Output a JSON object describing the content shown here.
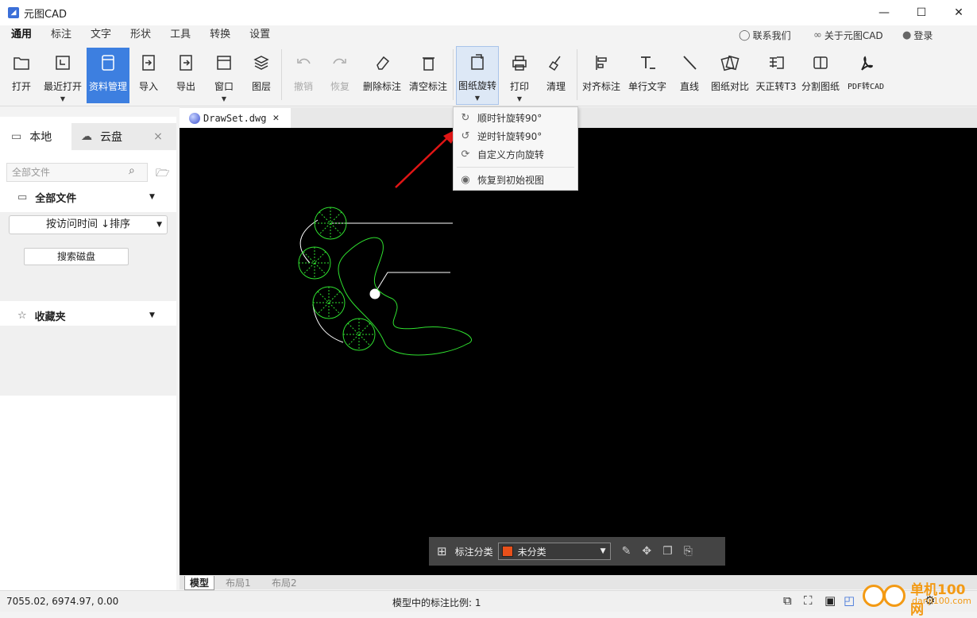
{
  "window": {
    "title": "元图CAD",
    "minimize": "—",
    "maximize": "☐",
    "close": "✕"
  },
  "menu": {
    "tabs": [
      "通用",
      "标注",
      "文字",
      "形状",
      "工具",
      "转换",
      "设置"
    ]
  },
  "top_links": {
    "contact": "联系我们",
    "about": "关于元图CAD",
    "login": "登录"
  },
  "ribbon": {
    "open": "打开",
    "recent": "最近打开",
    "manage": "资料管理",
    "import": "导入",
    "export": "导出",
    "window": "窗口",
    "layers": "图层",
    "undo": "撤销",
    "redo": "恢复",
    "delete_anno": "删除标注",
    "clear_anno": "清空标注",
    "rotate": "图纸旋转",
    "print": "打印",
    "clean": "清理",
    "align_anno": "对齐标注",
    "single_text": "单行文字",
    "line": "直线",
    "compare": "图纸对比",
    "tianzheng": "天正转T3",
    "split": "分割图纸",
    "pdf_to_cad": "PDF转CAD"
  },
  "rotate_menu": {
    "cw": "顺时针旋转90°",
    "ccw": "逆时针旋转90°",
    "custom": "自定义方向旋转",
    "reset": "恢复到初始视图"
  },
  "left_panel": {
    "tab_local": "本地",
    "tab_cloud": "云盘",
    "close": "×",
    "search_placeholder": "全部文件",
    "all_files": "全部文件",
    "sort": "按访问时间  ↓排序",
    "search_disk": "搜索磁盘",
    "favorites": "收藏夹"
  },
  "doc": {
    "tab_name": "DrawSet.dwg"
  },
  "anno_bar": {
    "label": "标注分类",
    "category": "未分类",
    "category_color": "#e8501a"
  },
  "layout_tabs": [
    "模型",
    "布局1",
    "布局2"
  ],
  "status": {
    "coords": "7055.02, 6974.97, 0.00",
    "scale": "模型中的标注比例: 1"
  },
  "watermark": {
    "text": "单机100网",
    "url": "danji100.com"
  }
}
